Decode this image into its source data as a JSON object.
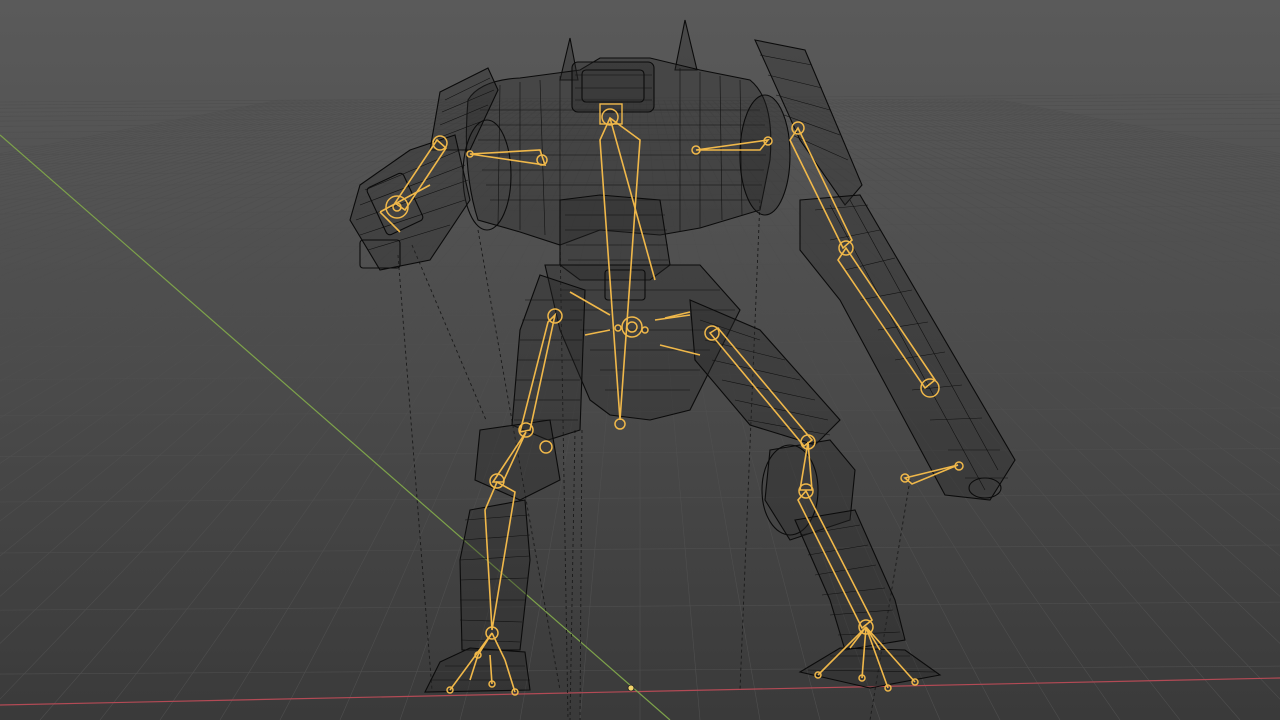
{
  "viewport": {
    "mode": "wireframe",
    "colors": {
      "background_top": "#595959",
      "background_bottom": "#3a3a3a",
      "grid_line": "#4b4b4b",
      "x_axis": "#b34a55",
      "y_axis": "#7da24a",
      "wireframe": "#0b0b0b",
      "bone": "#f0b84a",
      "origin_point": "#f2d36b"
    }
  },
  "scene": {
    "object": "robot-mech",
    "armature": "robot-armature",
    "mesh": "robot-mesh"
  }
}
